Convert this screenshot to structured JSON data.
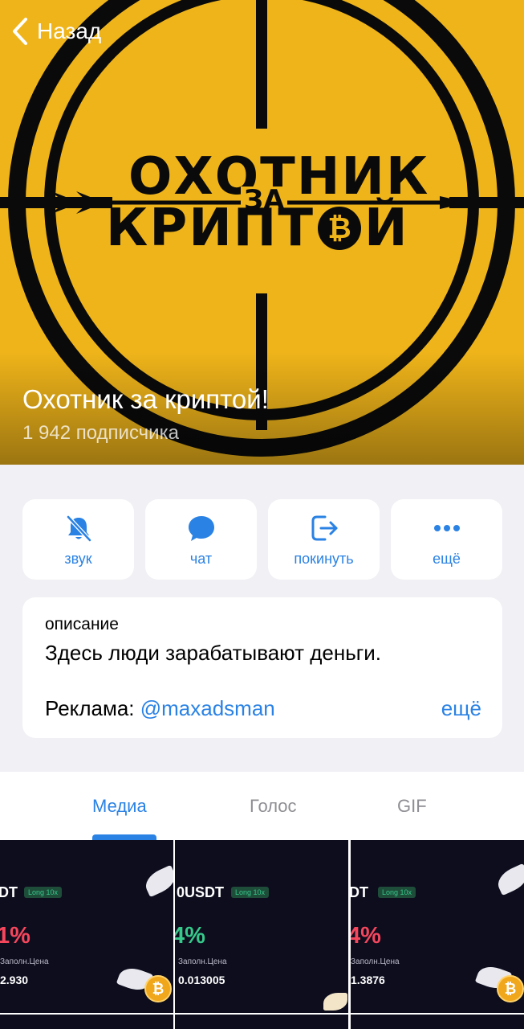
{
  "nav": {
    "back_label": "Назад"
  },
  "cover": {
    "logo_line1": "ОХОТНИК",
    "logo_middle": "ЗА",
    "logo_line2": "КРИПТ",
    "logo_line2_end": "Й",
    "logo_coin": "₿",
    "background_color": "#efb41a"
  },
  "channel": {
    "title": "Охотник за криптой!",
    "subscribers": "1 942 подписчика"
  },
  "actions": [
    {
      "label": "звук",
      "icon": "bell-muted-icon"
    },
    {
      "label": "чат",
      "icon": "chat-bubble-icon"
    },
    {
      "label": "покинуть",
      "icon": "leave-icon"
    },
    {
      "label": "ещё",
      "icon": "more-dots-icon"
    }
  ],
  "description": {
    "label": "описание",
    "text": "Здесь люди зарабатывают деньги.",
    "ad_prefix": "Реклама: ",
    "ad_link": "@maxadsman",
    "more": "ещё"
  },
  "tabs": [
    {
      "label": "Медиа",
      "active": true
    },
    {
      "label": "Голос",
      "active": false
    },
    {
      "label": "GIF",
      "active": false
    }
  ],
  "media": [
    {
      "pair": "DT",
      "badge": "Long 10x",
      "pct": "1%",
      "price_label": "Заполн.Цена",
      "price": "2.930",
      "coin": "₿"
    },
    {
      "pair": "0USDT",
      "badge": "Long 10x",
      "pct": "4%",
      "price_label": "Заполн.Цена",
      "price": "0.013005",
      "coin": ""
    },
    {
      "pair": "DT",
      "badge": "Long 10x",
      "pct": "4%",
      "price_label": "Заполн.Цена",
      "price": "1.3876",
      "coin": "₿"
    }
  ],
  "colors": {
    "accent": "#2a82e4",
    "loss": "#f5465c"
  }
}
